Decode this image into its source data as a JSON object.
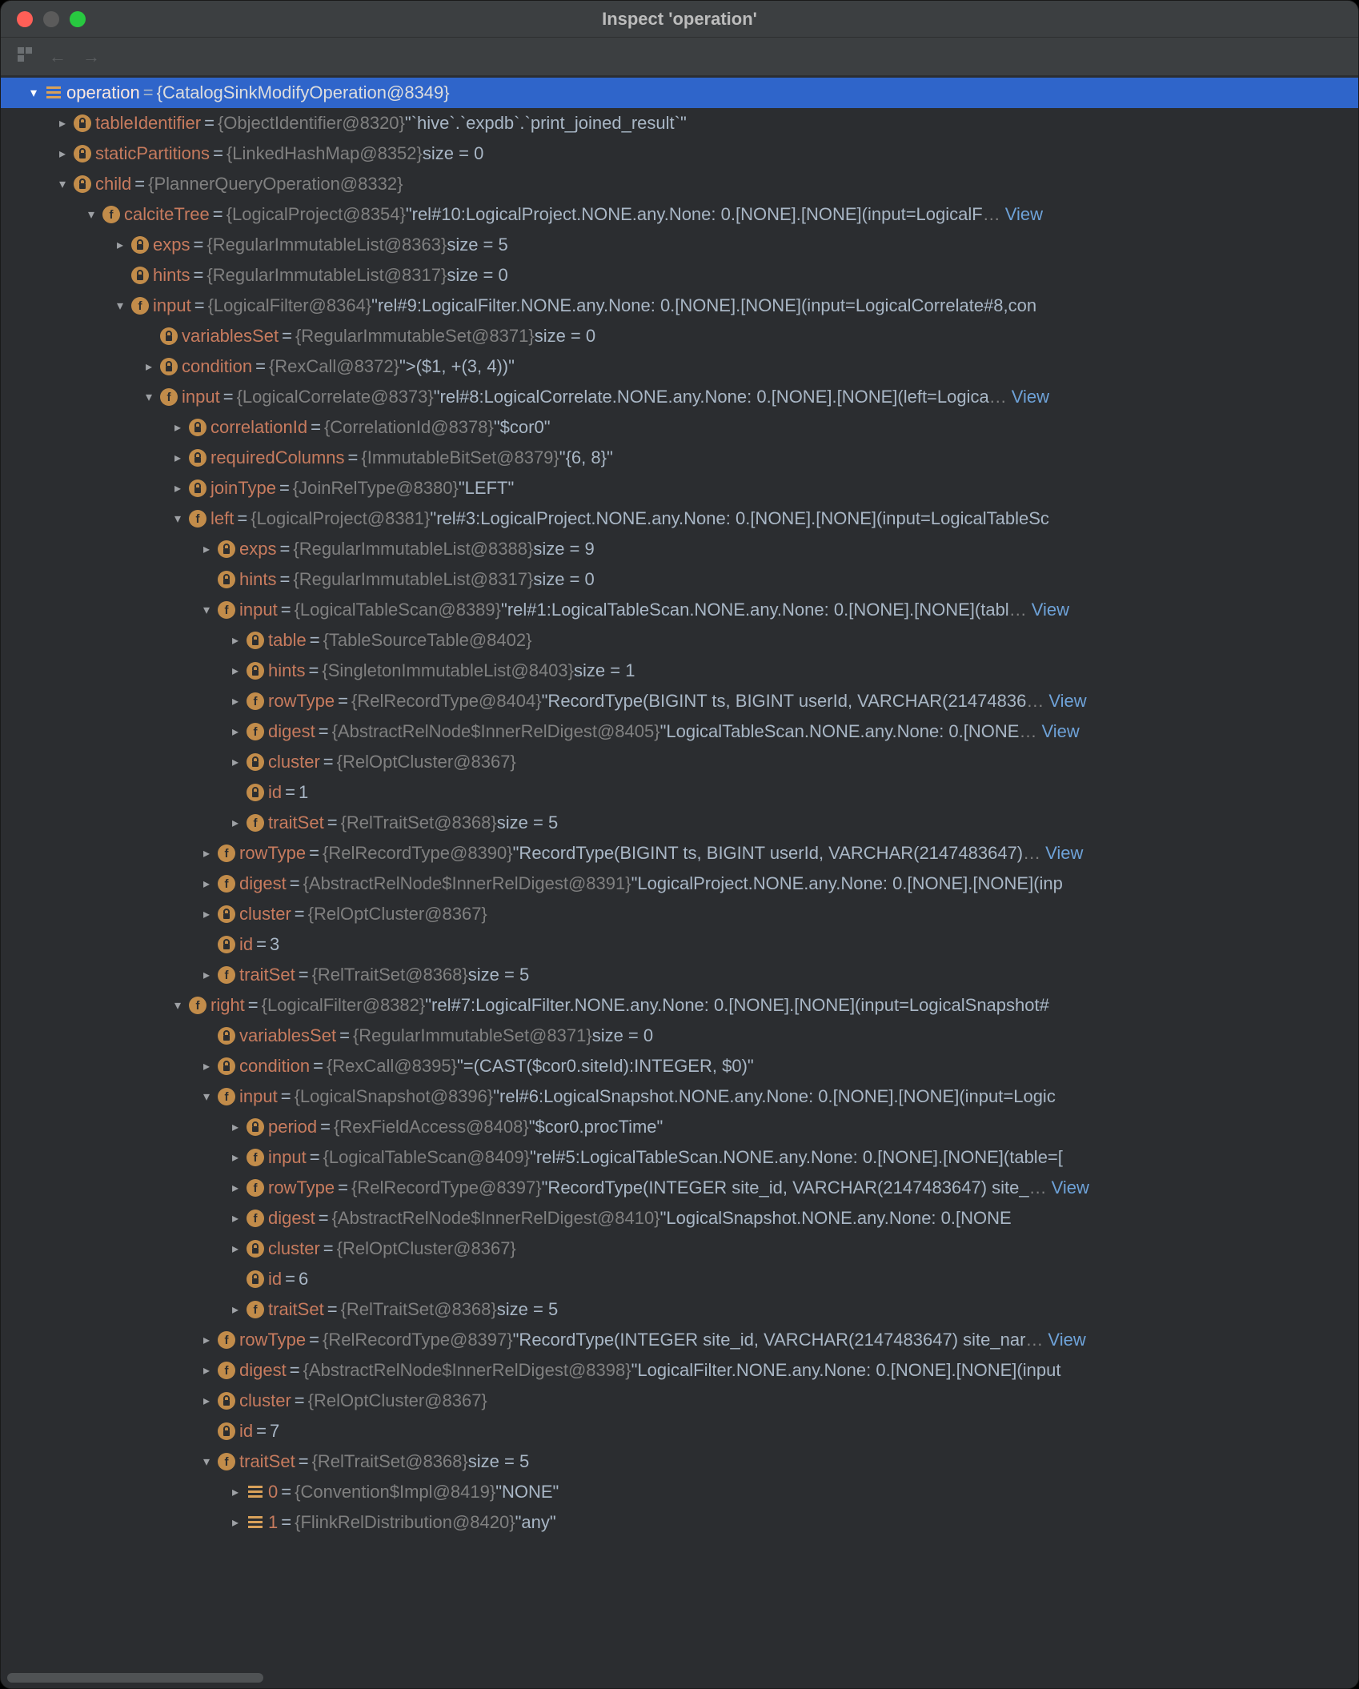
{
  "window": {
    "title": "Inspect 'operation'"
  },
  "toolbar": {
    "struct_icon": "structure",
    "back_icon": "back",
    "forward_icon": "forward"
  },
  "view_label": "View",
  "rows": [
    {
      "indent": 0,
      "arrow": "down",
      "icon": "list",
      "name": "operation",
      "type": "{CatalogSinkModifyOperation@8349}",
      "val": "",
      "selected": true
    },
    {
      "indent": 1,
      "arrow": "right",
      "icon": "lock",
      "name": "tableIdentifier",
      "type": "{ObjectIdentifier@8320}",
      "val": "\"`hive`.`expdb`.`print_joined_result`\""
    },
    {
      "indent": 1,
      "arrow": "right",
      "icon": "lock",
      "name": "staticPartitions",
      "type": "{LinkedHashMap@8352}",
      "val": " size = 0"
    },
    {
      "indent": 1,
      "arrow": "down",
      "icon": "lock",
      "name": "child",
      "type": "{PlannerQueryOperation@8332}",
      "val": ""
    },
    {
      "indent": 2,
      "arrow": "down",
      "icon": "f",
      "name": "calciteTree",
      "type": "{LogicalProject@8354}",
      "val": "\"rel#10:LogicalProject.NONE.any.None: 0.[NONE].[NONE](input=LogicalF",
      "ell": true,
      "view": true
    },
    {
      "indent": 3,
      "arrow": "right",
      "icon": "lock",
      "name": "exps",
      "type": "{RegularImmutableList@8363}",
      "val": " size = 5"
    },
    {
      "indent": 3,
      "arrow": "none",
      "icon": "lock",
      "name": "hints",
      "type": "{RegularImmutableList@8317}",
      "val": " size = 0"
    },
    {
      "indent": 3,
      "arrow": "down",
      "icon": "f",
      "name": "input",
      "type": "{LogicalFilter@8364}",
      "val": "\"rel#9:LogicalFilter.NONE.any.None: 0.[NONE].[NONE](input=LogicalCorrelate#8,con"
    },
    {
      "indent": 4,
      "arrow": "none",
      "icon": "lock",
      "name": "variablesSet",
      "type": "{RegularImmutableSet@8371}",
      "val": " size = 0"
    },
    {
      "indent": 4,
      "arrow": "right",
      "icon": "lock",
      "name": "condition",
      "type": "{RexCall@8372}",
      "val": "\">($1, +(3, 4))\""
    },
    {
      "indent": 4,
      "arrow": "down",
      "icon": "f",
      "name": "input",
      "type": "{LogicalCorrelate@8373}",
      "val": "\"rel#8:LogicalCorrelate.NONE.any.None: 0.[NONE].[NONE](left=Logica",
      "ell": true,
      "view": true
    },
    {
      "indent": 5,
      "arrow": "right",
      "icon": "lock",
      "name": "correlationId",
      "type": "{CorrelationId@8378}",
      "val": "\"$cor0\""
    },
    {
      "indent": 5,
      "arrow": "right",
      "icon": "lock",
      "name": "requiredColumns",
      "type": "{ImmutableBitSet@8379}",
      "val": "\"{6, 8}\""
    },
    {
      "indent": 5,
      "arrow": "right",
      "icon": "lock",
      "name": "joinType",
      "type": "{JoinRelType@8380}",
      "val": "\"LEFT\""
    },
    {
      "indent": 5,
      "arrow": "down",
      "icon": "f",
      "name": "left",
      "type": "{LogicalProject@8381}",
      "val": "\"rel#3:LogicalProject.NONE.any.None: 0.[NONE].[NONE](input=LogicalTableSc"
    },
    {
      "indent": 6,
      "arrow": "right",
      "icon": "lock",
      "name": "exps",
      "type": "{RegularImmutableList@8388}",
      "val": " size = 9"
    },
    {
      "indent": 6,
      "arrow": "none",
      "icon": "lock",
      "name": "hints",
      "type": "{RegularImmutableList@8317}",
      "val": " size = 0"
    },
    {
      "indent": 6,
      "arrow": "down",
      "icon": "f",
      "name": "input",
      "type": "{LogicalTableScan@8389}",
      "val": "\"rel#1:LogicalTableScan.NONE.any.None: 0.[NONE].[NONE](tabl",
      "ell": true,
      "view": true
    },
    {
      "indent": 7,
      "arrow": "right",
      "icon": "lock",
      "name": "table",
      "type": "{TableSourceTable@8402}",
      "val": ""
    },
    {
      "indent": 7,
      "arrow": "right",
      "icon": "lock",
      "name": "hints",
      "type": "{SingletonImmutableList@8403}",
      "val": " size = 1"
    },
    {
      "indent": 7,
      "arrow": "right",
      "icon": "f",
      "name": "rowType",
      "type": "{RelRecordType@8404}",
      "val": "\"RecordType(BIGINT ts, BIGINT userId, VARCHAR(21474836",
      "ell": true,
      "view": true
    },
    {
      "indent": 7,
      "arrow": "right",
      "icon": "f",
      "name": "digest",
      "type": "{AbstractRelNode$InnerRelDigest@8405}",
      "val": "\"LogicalTableScan.NONE.any.None: 0.[NONE",
      "ell": true,
      "view": true
    },
    {
      "indent": 7,
      "arrow": "right",
      "icon": "lock",
      "name": "cluster",
      "type": "{RelOptCluster@8367}",
      "val": ""
    },
    {
      "indent": 7,
      "arrow": "none",
      "icon": "lock",
      "name": "id",
      "type": "",
      "val": "1",
      "noeq": true
    },
    {
      "indent": 7,
      "arrow": "right",
      "icon": "f",
      "name": "traitSet",
      "type": "{RelTraitSet@8368}",
      "val": " size = 5"
    },
    {
      "indent": 6,
      "arrow": "right",
      "icon": "f",
      "name": "rowType",
      "type": "{RelRecordType@8390}",
      "val": "\"RecordType(BIGINT ts, BIGINT userId, VARCHAR(2147483647)",
      "ell": true,
      "view": true
    },
    {
      "indent": 6,
      "arrow": "right",
      "icon": "f",
      "name": "digest",
      "type": "{AbstractRelNode$InnerRelDigest@8391}",
      "val": "\"LogicalProject.NONE.any.None: 0.[NONE].[NONE](inp"
    },
    {
      "indent": 6,
      "arrow": "right",
      "icon": "lock",
      "name": "cluster",
      "type": "{RelOptCluster@8367}",
      "val": ""
    },
    {
      "indent": 6,
      "arrow": "none",
      "icon": "lock",
      "name": "id",
      "type": "",
      "val": "3",
      "noeq": true
    },
    {
      "indent": 6,
      "arrow": "right",
      "icon": "f",
      "name": "traitSet",
      "type": "{RelTraitSet@8368}",
      "val": " size = 5"
    },
    {
      "indent": 5,
      "arrow": "down",
      "icon": "f",
      "name": "right",
      "type": "{LogicalFilter@8382}",
      "val": "\"rel#7:LogicalFilter.NONE.any.None: 0.[NONE].[NONE](input=LogicalSnapshot#"
    },
    {
      "indent": 6,
      "arrow": "none",
      "icon": "lock",
      "name": "variablesSet",
      "type": "{RegularImmutableSet@8371}",
      "val": " size = 0"
    },
    {
      "indent": 6,
      "arrow": "right",
      "icon": "lock",
      "name": "condition",
      "type": "{RexCall@8395}",
      "val": "\"=(CAST($cor0.siteId):INTEGER, $0)\""
    },
    {
      "indent": 6,
      "arrow": "down",
      "icon": "f",
      "name": "input",
      "type": "{LogicalSnapshot@8396}",
      "val": "\"rel#6:LogicalSnapshot.NONE.any.None: 0.[NONE].[NONE](input=Logic"
    },
    {
      "indent": 7,
      "arrow": "right",
      "icon": "lock",
      "name": "period",
      "type": "{RexFieldAccess@8408}",
      "val": "\"$cor0.procTime\""
    },
    {
      "indent": 7,
      "arrow": "right",
      "icon": "f",
      "name": "input",
      "type": "{LogicalTableScan@8409}",
      "val": "\"rel#5:LogicalTableScan.NONE.any.None: 0.[NONE].[NONE](table=["
    },
    {
      "indent": 7,
      "arrow": "right",
      "icon": "f",
      "name": "rowType",
      "type": "{RelRecordType@8397}",
      "val": "\"RecordType(INTEGER site_id, VARCHAR(2147483647) site_",
      "ell": true,
      "view": true
    },
    {
      "indent": 7,
      "arrow": "right",
      "icon": "f",
      "name": "digest",
      "type": "{AbstractRelNode$InnerRelDigest@8410}",
      "val": "\"LogicalSnapshot.NONE.any.None: 0.[NONE"
    },
    {
      "indent": 7,
      "arrow": "right",
      "icon": "lock",
      "name": "cluster",
      "type": "{RelOptCluster@8367}",
      "val": ""
    },
    {
      "indent": 7,
      "arrow": "none",
      "icon": "lock",
      "name": "id",
      "type": "",
      "val": "6",
      "noeq": true
    },
    {
      "indent": 7,
      "arrow": "right",
      "icon": "f",
      "name": "traitSet",
      "type": "{RelTraitSet@8368}",
      "val": " size = 5"
    },
    {
      "indent": 6,
      "arrow": "right",
      "icon": "f",
      "name": "rowType",
      "type": "{RelRecordType@8397}",
      "val": "\"RecordType(INTEGER site_id, VARCHAR(2147483647) site_nar",
      "ell": true,
      "view": true
    },
    {
      "indent": 6,
      "arrow": "right",
      "icon": "f",
      "name": "digest",
      "type": "{AbstractRelNode$InnerRelDigest@8398}",
      "val": "\"LogicalFilter.NONE.any.None: 0.[NONE].[NONE](input"
    },
    {
      "indent": 6,
      "arrow": "right",
      "icon": "lock",
      "name": "cluster",
      "type": "{RelOptCluster@8367}",
      "val": ""
    },
    {
      "indent": 6,
      "arrow": "none",
      "icon": "lock",
      "name": "id",
      "type": "",
      "val": "7",
      "noeq": true
    },
    {
      "indent": 6,
      "arrow": "down",
      "icon": "f",
      "name": "traitSet",
      "type": "{RelTraitSet@8368}",
      "val": " size = 5"
    },
    {
      "indent": 7,
      "arrow": "right",
      "icon": "list",
      "name": "0",
      "type": "{Convention$Impl@8419}",
      "val": "\"NONE\""
    },
    {
      "indent": 7,
      "arrow": "right",
      "icon": "list",
      "name": "1",
      "type": "{FlinkRelDistribution@8420}",
      "val": "\"any\""
    }
  ]
}
